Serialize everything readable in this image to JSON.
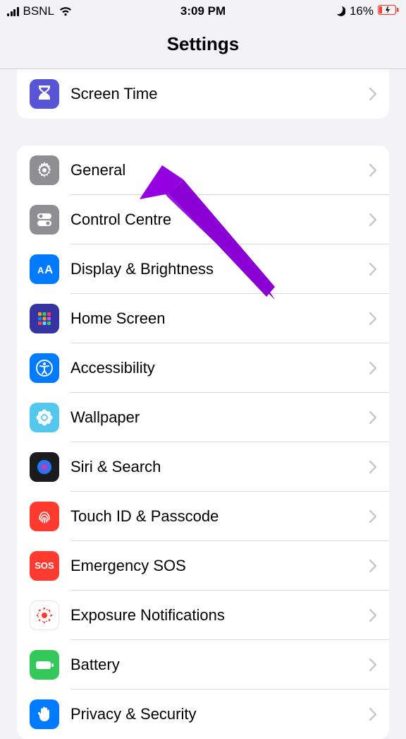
{
  "status_bar": {
    "carrier": "BSNL",
    "time": "3:09 PM",
    "battery_pct": "16%"
  },
  "header": {
    "title": "Settings"
  },
  "group1": {
    "items": [
      {
        "label": "Screen Time",
        "icon_bg": "#5856d6"
      }
    ]
  },
  "group2": {
    "items": [
      {
        "label": "General",
        "icon_bg": "#8e8e93"
      },
      {
        "label": "Control Centre",
        "icon_bg": "#8e8e93"
      },
      {
        "label": "Display & Brightness",
        "icon_bg": "#007aff"
      },
      {
        "label": "Home Screen",
        "icon_bg": "#3a3a9e"
      },
      {
        "label": "Accessibility",
        "icon_bg": "#007aff"
      },
      {
        "label": "Wallpaper",
        "icon_bg": "#00c7be"
      },
      {
        "label": "Siri & Search",
        "icon_bg": "#1c1c1e"
      },
      {
        "label": "Touch ID & Passcode",
        "icon_bg": "#ff3b30"
      },
      {
        "label": "Emergency SOS",
        "icon_bg": "#ff3b30"
      },
      {
        "label": "Exposure Notifications",
        "icon_bg": "#ffffff"
      },
      {
        "label": "Battery",
        "icon_bg": "#34c759"
      },
      {
        "label": "Privacy & Security",
        "icon_bg": "#007aff"
      }
    ]
  }
}
